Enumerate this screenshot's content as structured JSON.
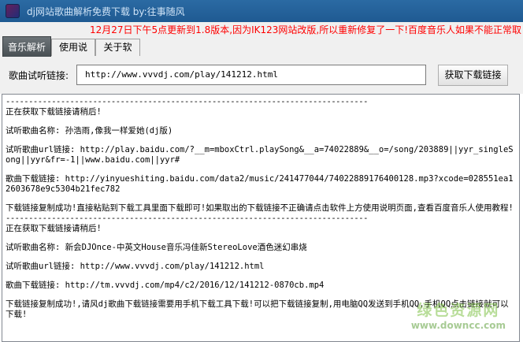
{
  "window": {
    "title": "dj网站歌曲解析免费下载 by:往事随风",
    "icon": "app-icon"
  },
  "notice": "12月27日下午5点更新到1.8版本,因为IK123网站改版,所以重新修复了一下!百度音乐人如果不能正常取",
  "tabs": [
    {
      "label": "音乐解析",
      "active": true
    },
    {
      "label": "使用说明",
      "active": false
    },
    {
      "label": "关于软件",
      "active": false
    }
  ],
  "form": {
    "label": "歌曲试听链接:",
    "url_value": "http://www.vvvdj.com/play/141212.html",
    "button_label": "获取下载链接"
  },
  "log": {
    "separator": "-------------------------------------------------------------------------------",
    "lines": [
      "正在获取下载链接请稍后!",
      "试听歌曲名称: 孙浩雨,像我一样爱她(dj版)",
      "试听歌曲url链接: http://play.baidu.com/?__m=mboxCtrl.playSong&__a=74022889&__o=/song/203889||yyr_singleSong||yyr&fr=-1||www.baidu.com||yyr#",
      "歌曲下载链接: http://yinyueshiting.baidu.com/data2/music/241477044/74022889176400128.mp3?xcode=028551ea12603678e9c5304b21fec782",
      "下载链接复制成功!直接粘贴到下载工具里面下载即可!如果取出的下载链接不正确请点击软件上方使用说明页面,查看百度音乐人使用教程!",
      "正在获取下载链接请稍后!",
      "试听歌曲名称: 新会DJOnce-中英文House音乐冯佳新StereoLove酒色迷幻串烧",
      "试听歌曲url链接: http://www.vvvdj.com/play/141212.html",
      "歌曲下载链接: http://tm.vvvdj.com/mp4/c2/2016/12/141212-0870cb.mp4",
      "下载链接复制成功!,请风dj歌曲下载链接需要用手机下载工具下载!可以把下载链接复制,用电脑QQ发送到手机QQ,手机QQ点击链接就可以下载!"
    ]
  },
  "watermark": {
    "text": "绿色资源网",
    "url": "www.downcc.com"
  },
  "colors": {
    "titlebar": "#1f5a92",
    "notice": "#ff0000",
    "active_tab": "#474e52"
  }
}
